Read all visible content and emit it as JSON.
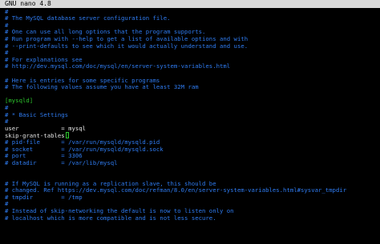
{
  "titlebar": {
    "program": "GNU nano 4.8"
  },
  "editor": {
    "lines": [
      {
        "text": "#",
        "kind": "comment"
      },
      {
        "text": "# The MySQL database server configuration file.",
        "kind": "comment"
      },
      {
        "text": "#",
        "kind": "comment"
      },
      {
        "text": "# One can use all long options that the program supports.",
        "kind": "comment"
      },
      {
        "text": "# Run program with --help to get a list of available options and with",
        "kind": "comment"
      },
      {
        "text": "# --print-defaults to see which it would actually understand and use.",
        "kind": "comment"
      },
      {
        "text": "#",
        "kind": "comment"
      },
      {
        "text": "# For explanations see",
        "kind": "comment"
      },
      {
        "text": "# http://dev.mysql.com/doc/mysql/en/server-system-variables.html",
        "kind": "comment"
      },
      {
        "text": "",
        "kind": "plain"
      },
      {
        "text": "# Here is entries for some specific programs",
        "kind": "comment"
      },
      {
        "text": "# The following values assume you have at least 32M ram",
        "kind": "comment"
      },
      {
        "text": "",
        "kind": "plain"
      },
      {
        "text": "[mysqld]",
        "kind": "section"
      },
      {
        "text": "#",
        "kind": "comment"
      },
      {
        "text": "# * Basic Settings",
        "kind": "comment"
      },
      {
        "text": "#",
        "kind": "comment"
      },
      {
        "text": "user            = mysql",
        "kind": "plain"
      },
      {
        "text": "skip-grant-tables",
        "kind": "plain",
        "cursor": true
      },
      {
        "text": "# pid-file      = /var/run/mysqld/mysqld.pid",
        "kind": "comment"
      },
      {
        "text": "# socket        = /var/run/mysqld/mysqld.sock",
        "kind": "comment"
      },
      {
        "text": "# port          = 3306",
        "kind": "comment"
      },
      {
        "text": "# datadir       = /var/lib/mysql",
        "kind": "comment"
      },
      {
        "text": "",
        "kind": "plain"
      },
      {
        "text": "",
        "kind": "plain"
      },
      {
        "text": "# If MySQL is running as a replication slave, this should be",
        "kind": "comment"
      },
      {
        "text": "# changed. Ref https://dev.mysql.com/doc/refman/8.0/en/server-system-variables.html#sysvar_tmpdir",
        "kind": "comment"
      },
      {
        "text": "# tmpdir        = /tmp",
        "kind": "comment"
      },
      {
        "text": "#",
        "kind": "comment"
      },
      {
        "text": "# Instead of skip-networking the default is now to listen only on",
        "kind": "comment"
      },
      {
        "text": "# localhost which is more compatible and is not less secure.",
        "kind": "comment"
      }
    ]
  }
}
